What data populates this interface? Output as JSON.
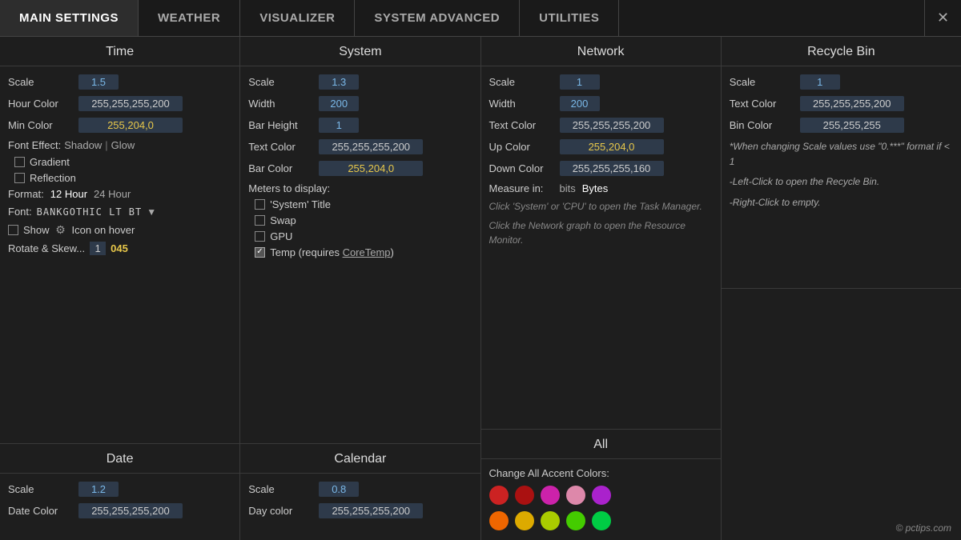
{
  "nav": {
    "tabs": [
      {
        "label": "MAIN SETTINGS",
        "active": true
      },
      {
        "label": "WEATHER",
        "active": false
      },
      {
        "label": "VISUALIZER",
        "active": false
      },
      {
        "label": "SYSTEM ADVANCED",
        "active": false
      },
      {
        "label": "UTILITIES",
        "active": false
      }
    ],
    "close_label": "✕"
  },
  "time": {
    "title": "Time",
    "scale_label": "Scale",
    "scale_value": "1.5",
    "hour_color_label": "Hour Color",
    "hour_color_value": "255,255,255,200",
    "min_color_label": "Min Color",
    "min_color_value": "255,204,0",
    "font_effect_label": "Font Effect:",
    "font_shadow": "Shadow",
    "font_separator": "|",
    "font_glow": "Glow",
    "gradient_label": "Gradient",
    "reflection_label": "Reflection",
    "format_label": "Format:",
    "format_12": "12 Hour",
    "format_24": "24 Hour",
    "font_label": "Font:",
    "font_name": "BankGothic Lt BT",
    "show_label": "Show",
    "show_icon_label": "Icon on hover",
    "rotate_label": "Rotate & Skew...",
    "rotate_value": "1",
    "rotate_yellow": "045"
  },
  "system": {
    "title": "System",
    "scale_label": "Scale",
    "scale_value": "1.3",
    "width_label": "Width",
    "width_value": "200",
    "bar_height_label": "Bar Height",
    "bar_height_value": "1",
    "text_color_label": "Text Color",
    "text_color_value": "255,255,255,200",
    "bar_color_label": "Bar Color",
    "bar_color_value": "255,204,0",
    "meters_label": "Meters to display:",
    "meter_system": "'System' Title",
    "meter_swap": "Swap",
    "meter_gpu": "GPU",
    "meter_temp": "Temp (requires ",
    "meter_temp_link": "CoreTemp",
    "meter_temp_close": ")"
  },
  "network": {
    "title": "Network",
    "scale_label": "Scale",
    "scale_value": "1",
    "width_label": "Width",
    "width_value": "200",
    "text_color_label": "Text Color",
    "text_color_value": "255,255,255,200",
    "up_color_label": "Up Color",
    "up_color_value": "255,204,0",
    "down_color_label": "Down Color",
    "down_color_value": "255,255,255,160",
    "measure_label": "Measure in:",
    "measure_bits": "bits",
    "measure_bytes": "Bytes",
    "info1": "Click 'System' or 'CPU' to open the Task Manager.",
    "info2": "Click the Network graph to open the Resource Monitor."
  },
  "recycle": {
    "title": "Recycle Bin",
    "scale_label": "Scale",
    "scale_value": "1",
    "text_color_label": "Text Color",
    "text_color_value": "255,255,255,200",
    "bin_color_label": "Bin Color",
    "bin_color_value": "255,255,255",
    "note1": "*When changing Scale values use \"0.***\" format if < 1",
    "note2": "-Left-Click to open the Recycle Bin.",
    "note3": "-Right-Click to empty."
  },
  "date": {
    "title": "Date",
    "scale_label": "Scale",
    "scale_value": "1.2",
    "date_color_label": "Date Color",
    "date_color_value": "255,255,255,200"
  },
  "calendar": {
    "title": "Calendar",
    "scale_label": "Scale",
    "scale_value": "0.8",
    "day_color_label": "Day color",
    "day_color_value": "255,255,255,200"
  },
  "all": {
    "title": "All",
    "accent_label": "Change All Accent Colors:",
    "circles_row1": [
      {
        "color": "#cc2222"
      },
      {
        "color": "#aa1111"
      },
      {
        "color": "#cc22aa"
      },
      {
        "color": "#dd88aa"
      },
      {
        "color": "#aa22cc"
      }
    ],
    "circles_row2": [
      {
        "color": "#ee6600"
      },
      {
        "color": "#ddaa00"
      },
      {
        "color": "#aacc00"
      },
      {
        "color": "#44cc00"
      },
      {
        "color": "#00cc44"
      }
    ]
  },
  "copyright": "© pctips.com"
}
